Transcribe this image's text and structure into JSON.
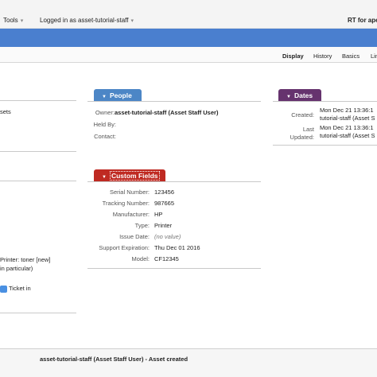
{
  "topbar": {
    "tools_label": "Tools",
    "logged_in_label": "Logged in as asset-tutorial-staff",
    "rt_for": "RT for ape"
  },
  "page_nav": {
    "items": [
      "Display",
      "History",
      "Basics",
      "Lin"
    ],
    "active": "Display"
  },
  "left_partial": {
    "sets": "sets",
    "printer_toner": "Printer: toner [new]",
    "in_particular": "in particular)",
    "ticket_in": "Ticket in"
  },
  "people": {
    "title": "People",
    "rows": [
      {
        "label": "Owner:",
        "value": "asset-tutorial-staff (Asset Staff User)"
      },
      {
        "label": "Held By:",
        "value": ""
      },
      {
        "label": "Contact:",
        "value": ""
      }
    ]
  },
  "dates": {
    "title": "Dates",
    "created_label": "Created:",
    "created_line1": "Mon Dec 21 13:36:1",
    "created_line2": "tutorial-staff (Asset S",
    "updated_label_1": "Last",
    "updated_label_2": "Updated:",
    "updated_line1": "Mon Dec 21 13:36:1",
    "updated_line2": "tutorial-staff (Asset S"
  },
  "custom_fields": {
    "title": "Custom Fields",
    "rows": [
      {
        "label": "Serial Number:",
        "value": "123456"
      },
      {
        "label": "Tracking Number:",
        "value": "987665"
      },
      {
        "label": "Manufacturer:",
        "value": "HP"
      },
      {
        "label": "Type:",
        "value": "Printer"
      },
      {
        "label": "Issue Date:",
        "value": "(no value)"
      },
      {
        "label": "Support Expiration:",
        "value": "Thu Dec 01 2016"
      },
      {
        "label": "Model:",
        "value": "CF12345"
      }
    ]
  },
  "history": {
    "entry": "asset-tutorial-staff (Asset Staff User) - Asset created"
  },
  "colors": {
    "blue_bar": "#4a7fcf",
    "people_tab": "#4c86c6",
    "dates_tab": "#66336e",
    "custom_fields_tab": "#bf2a22"
  }
}
